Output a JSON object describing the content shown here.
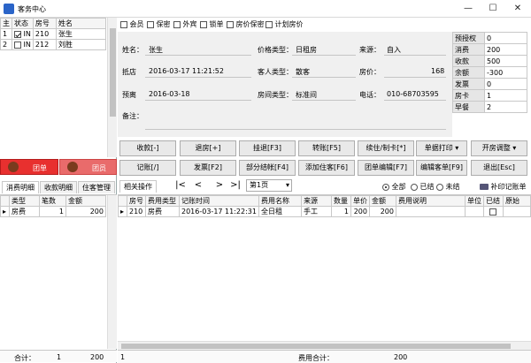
{
  "window": {
    "title": "客务中心",
    "min": "—",
    "max": "☐",
    "close": "✕"
  },
  "room_list": {
    "headers": [
      "主",
      "状态",
      "房号",
      "姓名"
    ],
    "rows": [
      {
        "num": "1",
        "checked": true,
        "status": "IN",
        "room": "210",
        "name": "张生"
      },
      {
        "num": "2",
        "checked": false,
        "status": "IN",
        "room": "212",
        "name": "刘胜"
      }
    ]
  },
  "group_buttons": {
    "single": "团单",
    "member": "团员"
  },
  "left_tabs": [
    "消费明细",
    "收款明细",
    "住客管理"
  ],
  "left_grid": {
    "headers": [
      "类型",
      "笔数",
      "金额"
    ],
    "rows": [
      {
        "type": "房费",
        "count": "1",
        "amount": "200"
      }
    ],
    "footer": {
      "label": "合计：",
      "count": "1",
      "amount": "200"
    }
  },
  "top_checks": [
    "会员",
    "保密",
    "外宾",
    "锁单",
    "房价保密",
    "计划房价"
  ],
  "guest_form": {
    "name_label": "姓名：",
    "name": "张生",
    "price_type_label": "价格类型：",
    "price_type": "日租房",
    "source_label": "来源：",
    "source": "自入",
    "arrive_label": "抵店",
    "arrive": "2016-03-17 11:21:52",
    "guest_type_label": "客人类型：",
    "guest_type": "散客",
    "room_price_label": "房价：",
    "room_price": "168",
    "depart_label": "预离",
    "depart": "2016-03-18",
    "room_type_label": "房间类型：",
    "room_type": "标准间",
    "phone_label": "电话：",
    "phone": "010-68703595",
    "note_label": "备注："
  },
  "summary": [
    {
      "key": "预授权",
      "value": "0"
    },
    {
      "key": "消费",
      "value": "200"
    },
    {
      "key": "收款",
      "value": "500"
    },
    {
      "key": "余额",
      "value": "-300"
    },
    {
      "key": "发票",
      "value": "0"
    },
    {
      "key": "房卡",
      "value": "1"
    },
    {
      "key": "早餐",
      "value": "2"
    }
  ],
  "actions_row1": [
    "收款[-]",
    "退房[+]",
    "挂退[F3]",
    "转账[F5]",
    "续住/制卡[*]",
    "单据打印",
    "开房调整"
  ],
  "actions_row2": [
    "记账[/]",
    "发票[F2]",
    "部分结帐[F4]",
    "添加住客[F6]",
    "团单编辑[F7]",
    "编辑客单[F9]",
    "退出[Esc]"
  ],
  "toolbar": {
    "related_tab": "相关操作",
    "page": "第1页",
    "filters": [
      "全部",
      "已结",
      "未结"
    ],
    "reprint": "补印记账单"
  },
  "detail_grid": {
    "headers": [
      "房号",
      "费用类型",
      "记账时间",
      "费用名称",
      "来源",
      "数量",
      "单价",
      "金额",
      "费用说明",
      "单位",
      "已结",
      "原始"
    ],
    "rows": [
      {
        "room": "210",
        "fee_type": "房费",
        "time": "2016-03-17 11:22:31",
        "fee_name": "全日租",
        "source": "手工",
        "qty": "1",
        "price": "200",
        "amount": "200"
      }
    ],
    "footer": {
      "count": "1",
      "label": "费用合计：",
      "total": "200"
    }
  }
}
